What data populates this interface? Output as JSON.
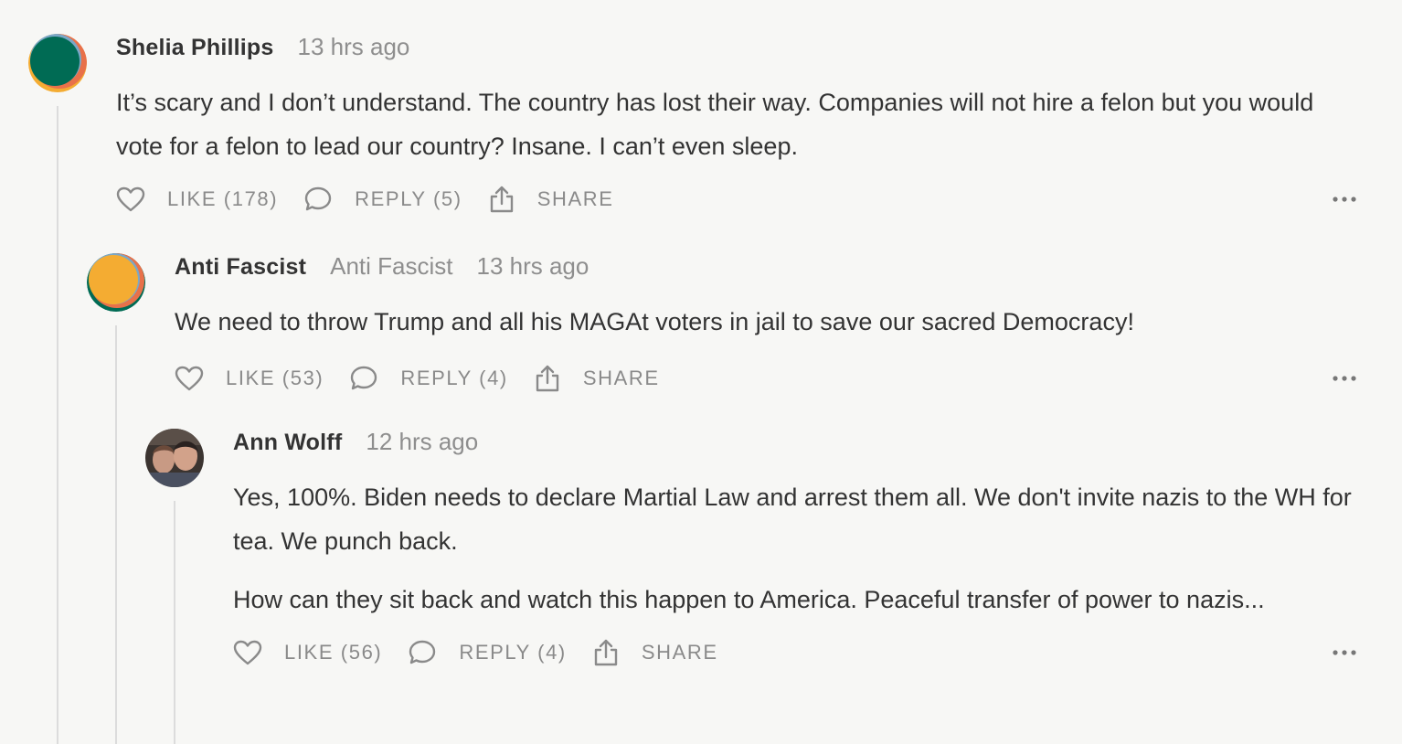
{
  "comments": [
    {
      "author": "Shelia Phillips",
      "time": "13 hrs ago",
      "paragraphs": [
        "It’s scary and I don’t understand. The country has lost their way. Companies will not hire a felon but you would vote for a felon to lead our country? Insane. I can’t even sleep."
      ],
      "like": "LIKE (178)",
      "reply": "REPLY (5)",
      "share": "SHARE",
      "avatar_colors": [
        "#f4ac32",
        "#e8714a",
        "#006b54"
      ]
    },
    {
      "author": "Anti Fascist",
      "handle": "Anti Fascist",
      "time": "13 hrs ago",
      "paragraphs": [
        "We need to throw Trump and all his MAGAt voters in jail to save our sacred Democracy!"
      ],
      "like": "LIKE (53)",
      "reply": "REPLY (4)",
      "share": "SHARE",
      "avatar_colors": [
        "#006b54",
        "#e8714a",
        "#f4ac32"
      ]
    },
    {
      "author": "Ann Wolff",
      "time": "12 hrs ago",
      "paragraphs": [
        "Yes, 100%. Biden needs to declare Martial Law and arrest them all. We don't invite nazis to the WH for tea. We punch back.",
        "How can they sit back and watch this happen to America. Peaceful transfer of power to nazis..."
      ],
      "like": "LIKE (56)",
      "reply": "REPLY (4)",
      "share": "SHARE"
    }
  ],
  "icons": {
    "like": "heart-icon",
    "reply": "speech-bubble-icon",
    "share": "share-upload-icon",
    "more": "ellipsis-icon"
  },
  "colors": {
    "background": "#f7f7f5",
    "text": "#333333",
    "muted": "#8e8e8e",
    "thread_line": "#dcdcdc"
  }
}
